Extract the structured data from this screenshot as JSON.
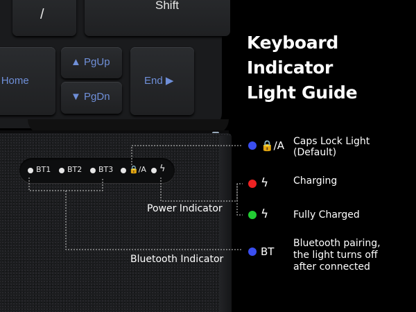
{
  "title_line1": "Keyboard Indicator",
  "title_line2": "Light Guide",
  "keys": {
    "slash": "/",
    "shift": "Shift",
    "home": "◀  Home",
    "pgup": "▲ PgUp",
    "pgdn": "▼ PgDn",
    "end": "End  ▶"
  },
  "strip": {
    "bt1": "BT1",
    "bt2": "BT2",
    "bt3": "BT3",
    "caps": "🔒/A",
    "power": "ϟ"
  },
  "callouts": {
    "power": "Power Indicator",
    "bluetooth": "Bluetooth Indicator"
  },
  "legend": [
    {
      "symbol": "🔒/A",
      "color": "#3a4ef0",
      "text1": "Caps Lock Light",
      "text2": "(Default)"
    },
    {
      "symbol": "ϟ",
      "color": "#ee2222",
      "text1": "Charging"
    },
    {
      "symbol": "ϟ",
      "color": "#22cc33",
      "text1": "Fully Charged"
    },
    {
      "symbol": "BT",
      "color": "#3a4ef0",
      "text1": "Bluetooth pairing,",
      "text2": "the light turns off",
      "text3": "after connected"
    }
  ]
}
